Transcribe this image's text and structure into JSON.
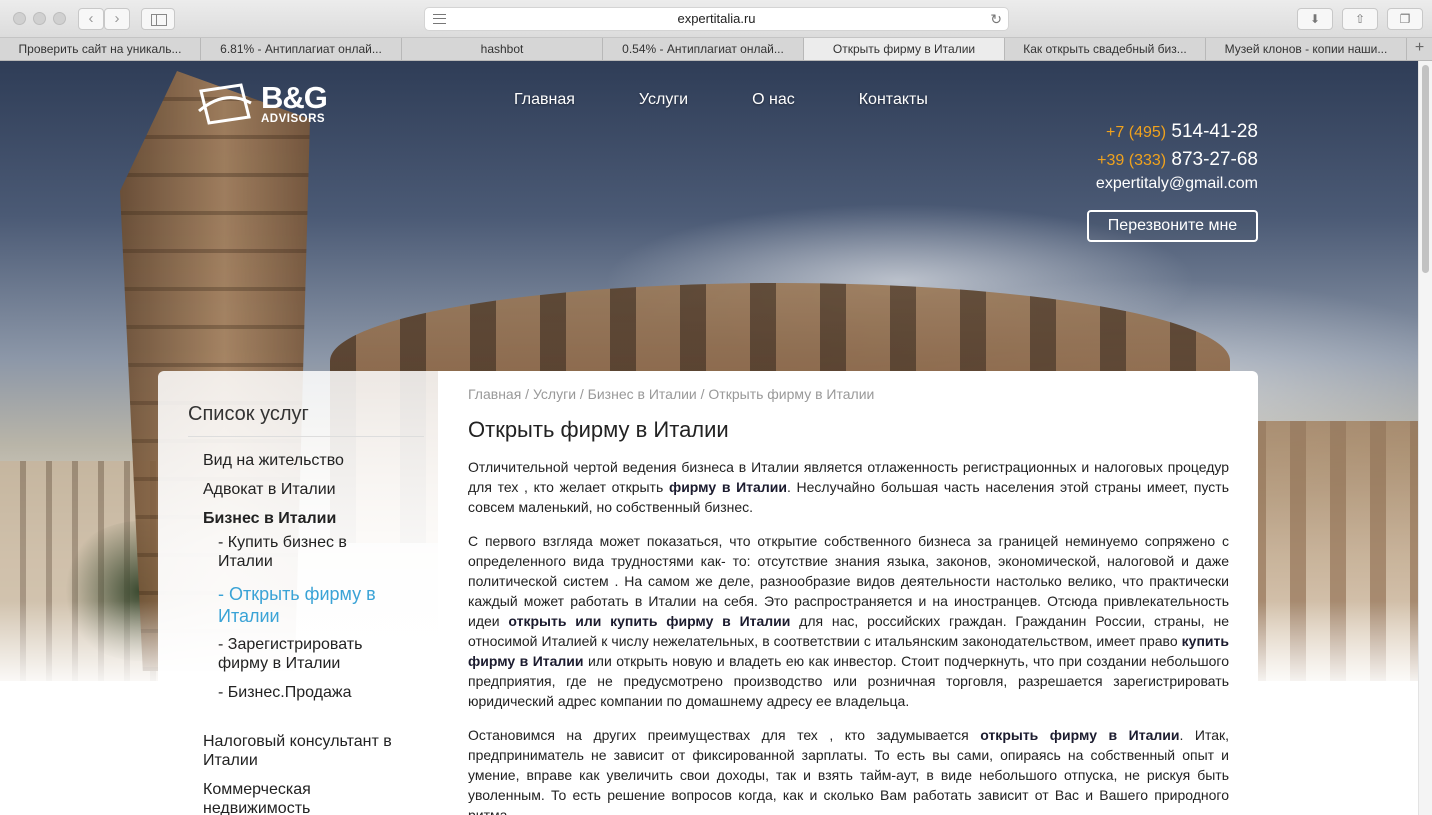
{
  "browser": {
    "url": "expertitalia.ru",
    "tabs": [
      {
        "label": "Проверить сайт на уникаль..."
      },
      {
        "label": "6.81% - Антиплагиат онлай..."
      },
      {
        "label": "hashbot"
      },
      {
        "label": "0.54% - Антиплагиат онлай..."
      },
      {
        "label": "Открыть фирму в Италии"
      },
      {
        "label": "Как открыть свадебный биз..."
      },
      {
        "label": "Музей клонов - копии наши..."
      }
    ],
    "active_tab_index": 4,
    "new_tab_label": "+"
  },
  "header": {
    "logo_title": "B&G",
    "logo_subtitle": "ADVISORS",
    "nav": [
      "Главная",
      "Услуги",
      "О нас",
      "Контакты"
    ],
    "phones": [
      {
        "code": "+7 (495)",
        "number": "514-41-28"
      },
      {
        "code": "+39 (333)",
        "number": "873-27-68"
      }
    ],
    "email": "expertitaly@gmail.com",
    "callback_label": "Перезвоните мне",
    "accent_color": "#f0a21d"
  },
  "sidebar": {
    "title": "Список услуг",
    "items": [
      {
        "label": "Вид на жительство"
      },
      {
        "label": "Адвокат в Италии"
      },
      {
        "label": "Бизнес в Италии"
      },
      {
        "label": "- Купить бизнес в Италии"
      },
      {
        "label": "- Открыть фирму в Италии"
      },
      {
        "label": "- Зарегистрировать фирму в Италии"
      },
      {
        "label": "- Бизнес.Продажа"
      },
      {
        "label": "Налоговый консультант в Италии"
      },
      {
        "label": "Коммерческая недвижимость"
      }
    ],
    "active_color": "#3aa3d6"
  },
  "main": {
    "breadcrumb": "Главная / Услуги / Бизнес в Италии / Открыть фирму в Италии",
    "title": "Открыть фирму в Италии",
    "paragraphs": [
      {
        "p1a": "Отличительной чертой ведения бизнеса в Италии является отлаженность регистрационных и налоговых  процедур для тех , кто желает открыть ",
        "p1b": "фирму в Италии",
        "p1c": ". Неслучайно большая часть населения этой страны имеет, пусть совсем маленький, но собственный бизнес."
      },
      {
        "p2a": "С первого взгляда может показаться, что открытие собственного бизнеса за границей неминуемо сопряжено с определенного вида трудностями как- то: отсутствие знания языка, законов, экономической, налоговой и даже политической систем . На самом же деле, разнообразие видов деятельности  настолько велико, что практически каждый может работать в Италии на себя. Это распространяется и на иностранцев. Отсюда привлекательность идеи ",
        "p2b": "открыть или купить  фирму в Италии",
        "p2c": " для нас, российских граждан. Гражданин России, страны, не относимой Италией к числу нежелательных, в соответствии с итальянским законодательством, имеет право ",
        "p2d": "купить фирму в Италии",
        "p2e": " или открыть  новую и владеть ею как инвестор. Стоит подчеркнуть, что при создании небольшого предприятия, где не предусмотрено производство или розничная торговля, разрешается зарегистрировать юридический адрес компании по домашнему адресу ее владельца."
      },
      {
        "p3a": "Остановимся на других преимуществах для тех , кто задумывается  ",
        "p3b": "открыть фирму в Италии",
        "p3c": ". Итак, предприниматель не зависит от фиксированной зарплаты. То есть вы сами, опираясь на собственный опыт и умение, вправе как увеличить свои доходы, так и взять тайм-аут, в виде небольшого отпуска, не рискуя быть уволенным. То есть решение вопросов когда, как и сколько Вам работать зависит от Вас и Вашего природного ритма."
      }
    ]
  }
}
